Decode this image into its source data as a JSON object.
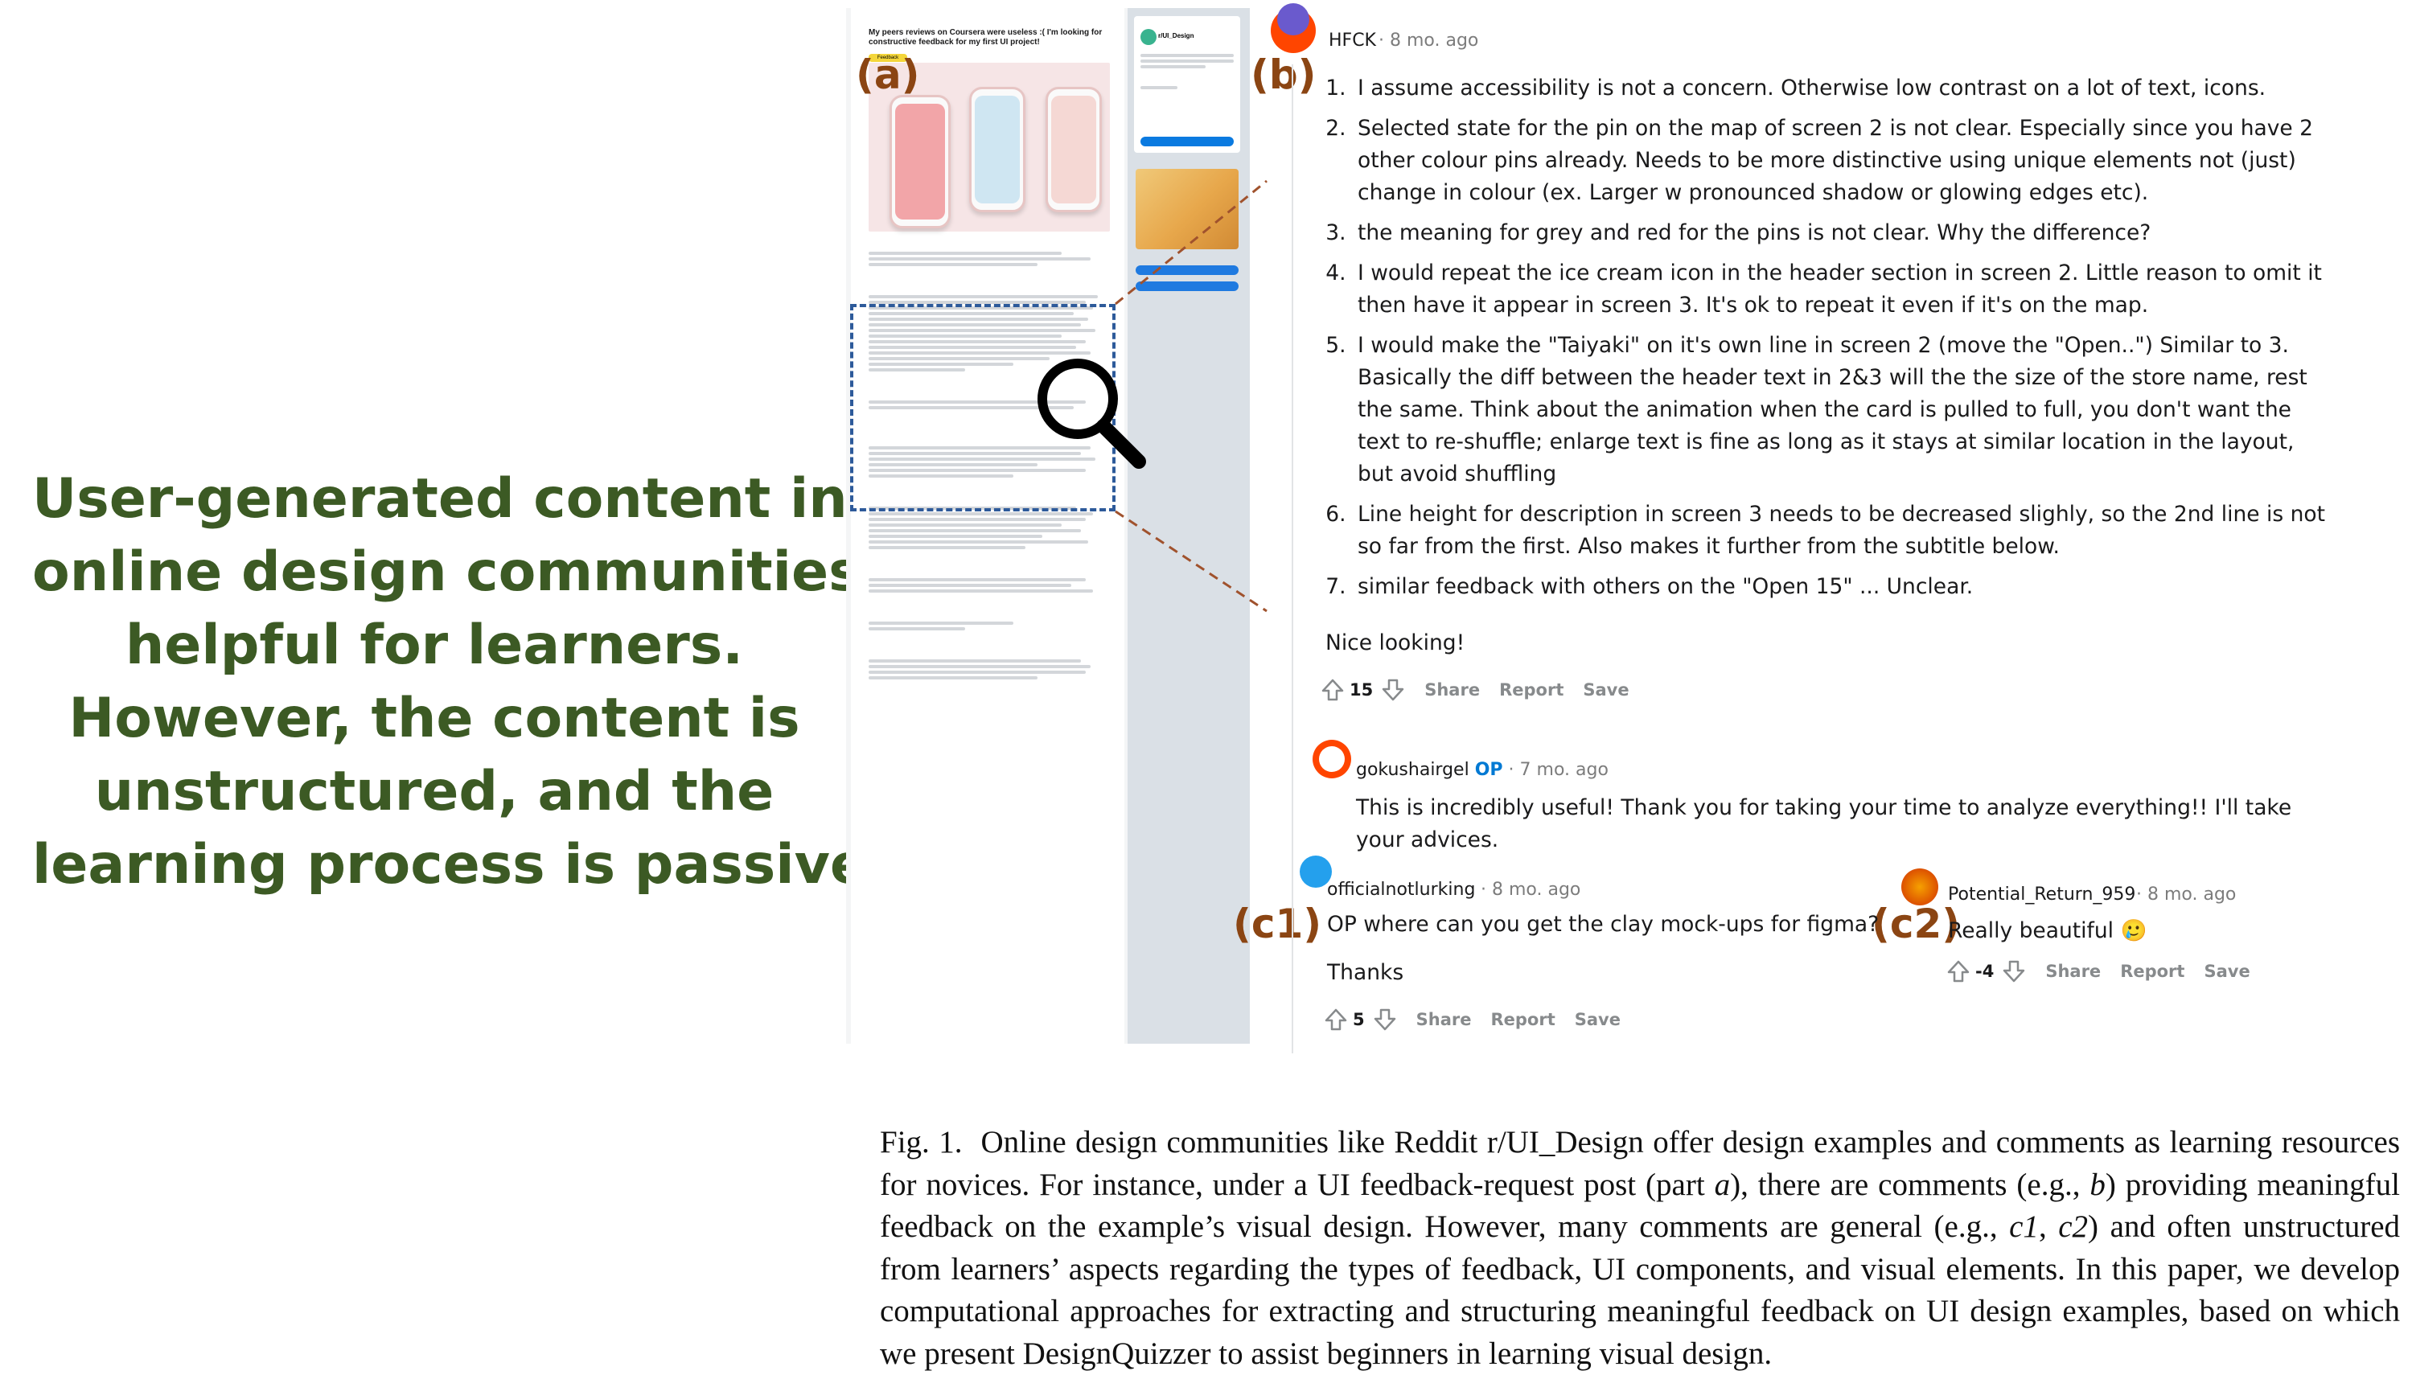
{
  "tagline": {
    "lines": [
      "User-generated content in",
      "online design communities is",
      "helpful for learners.",
      "However,  the content is",
      "unstructured, and the",
      "learning process is passive."
    ]
  },
  "screenshot": {
    "post_title": "My peers reviews on Coursera were useless :( I'm looking for constructive feedback for my first UI project!",
    "post_flair": "Feedback Request",
    "sidebar_title": "r/UI_Design"
  },
  "markers": {
    "a": "(a)",
    "b": "(b)",
    "c1": "(c1)",
    "c2": "(c2)"
  },
  "comment_b": {
    "user": "HFCK",
    "time": "· 8 mo. ago",
    "items": [
      "I assume accessibility is not a concern. Otherwise low contrast on a lot of text, icons.",
      "Selected state for the pin on the map of screen 2 is not clear. Especially since you have 2 other colour pins already. Needs to be more distinctive using unique elements not (just) change in colour (ex. Larger w pronounced shadow or glowing edges etc).",
      "the meaning for grey and red for the pins is not clear. Why the difference?",
      "I would repeat the ice cream icon in the header section in screen 2. Little reason to omit it then have it appear in screen 3. It's ok to repeat it even if it's on the map.",
      "I would make the \"Taiyaki\" on it's own line in screen 2 (move the \"Open..\") Similar to 3. Basically the diff between the header text in 2&3 will the the size of the store name, rest the same. Think about the animation when the card is pulled to full, you don't want the text to re-shuffle; enlarge text is fine as long as it stays at similar location in the layout, but avoid shuffling",
      "Line height for description in screen 3 needs to be decreased slighly, so the 2nd line is not so far from the first. Also makes it further from the subtitle below.",
      "similar feedback with others on the \"Open 15\" ... Unclear."
    ],
    "closing": "Nice looking!",
    "score": "15",
    "share": "Share",
    "report": "Report",
    "save": "Save"
  },
  "reply_op": {
    "user": "gokushairgel",
    "op": "OP",
    "time": "· 7 mo. ago",
    "text": "This is incredibly useful! Thank you for taking your time to analyze everything!! I'll take your advices."
  },
  "comment_c1": {
    "user": "officialnotlurking",
    "time": "· 8 mo. ago",
    "line1": "OP where can you get the clay mock-ups for figma?",
    "line2": "Thanks",
    "score": "5",
    "share": "Share",
    "report": "Report",
    "save": "Save"
  },
  "comment_c2": {
    "user": "Potential_Return_959",
    "time": "· 8 mo. ago",
    "text": "Really beautiful",
    "emoji": "🥲",
    "score": "-4",
    "share": "Share",
    "report": "Report",
    "save": "Save"
  },
  "caption": {
    "label": "Fig. 1.",
    "t1": "Online design communities like Reddit r/UI_Design offer design examples and comments as learning resources for novices. For instance, under a UI feedback-request post (part ",
    "a": "a",
    "t2": "), there are comments (e.g., ",
    "b": "b",
    "t3": ") providing meaningful feedback on the example’s visual design. However, many comments are general (e.g., ",
    "c1": "c1",
    "t4": ", ",
    "c2": "c2",
    "t5": ") and often unstructured from learners’ aspects regarding the types of feedback, UI components, and visual elements. In this paper, we develop computational approaches for extracting and structuring meaningful feedback on UI design examples, based on which we present DesignQuizzer to assist beginners in learning visual design."
  },
  "colors": {
    "tagline": "#3c5a24",
    "marker": "#8b4513",
    "dashed_box": "#2d5a9a",
    "connector": "#a0522d",
    "op": "#0079d3"
  }
}
